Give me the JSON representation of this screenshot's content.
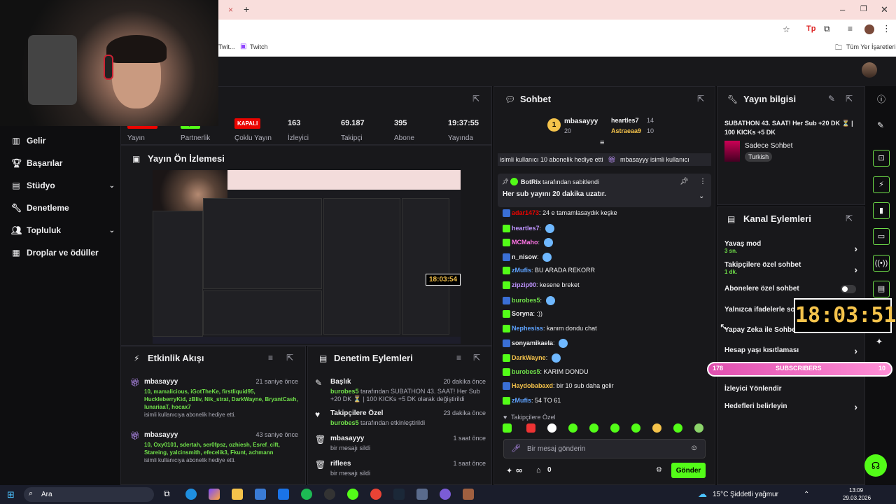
{
  "browser": {
    "bookmarks": {
      "twitch": "Twitch",
      "all": "Tüm Yer İşaretleri",
      "partial": "Twit..."
    }
  },
  "sidebar": {
    "items": [
      {
        "label": "Gelir",
        "icon": "chart-icon"
      },
      {
        "label": "Başarılar",
        "icon": "trophy-icon"
      },
      {
        "label": "Stüdyo",
        "icon": "studio-icon",
        "chevron": "⌄"
      },
      {
        "label": "Denetleme",
        "icon": "wrench-icon"
      },
      {
        "label": "Topluluk",
        "icon": "people-icon",
        "chevron": "⌄"
      },
      {
        "label": "Droplar ve ödüller",
        "icon": "gift-icon"
      }
    ]
  },
  "stats": {
    "title_partial": "i",
    "live_badge": "YAYINDA",
    "partner_badge": "AÇIK",
    "multi_badge": "KAPALI",
    "items": [
      {
        "label": "Yayın"
      },
      {
        "label": "Partnerlik"
      },
      {
        "label": "Çoklu Yayın"
      },
      {
        "value": "163",
        "label": "İzleyici"
      },
      {
        "value": "69.187",
        "label": "Takipçi"
      },
      {
        "value": "395",
        "label": "Abone"
      },
      {
        "value": "19:37:55",
        "label": "Yayında"
      }
    ]
  },
  "preview": {
    "title": "Yayın Ön İzlemesi",
    "mini_clock": "18:03:54"
  },
  "activity": {
    "title": "Etkinlik Akışı",
    "entries": [
      {
        "name": "mbasayyy",
        "time": "21 saniye önce",
        "list": "10, mamalicious, iGotTheKe, firstliquid95, HuckleberryKid, zBliv, Nik_strat, DarkWayne, BryantCash, lunariaaT, hocax7",
        "note": "isimli kullanıcıya abonelik hediye etti."
      },
      {
        "name": "mbasayyy",
        "time": "43 saniye önce",
        "list": "10, Oxy0101, sdertah, ser0fpsz, ozhiesh, Esref_cift, Stareing, yalcinsmith, efecelik3, Fkunt, achmann",
        "note": "isimli kullanıcıya abonelik hediye etti."
      }
    ]
  },
  "moderation": {
    "title": "Denetim Eylemleri",
    "entries": [
      {
        "title": "Başlık",
        "time": "20 dakika önce",
        "user": "burobes5",
        "text": " tarafından SUBATHON 43. SAAT! Her Sub +20 DK ⏳ | 100 KICKs +5 DK olarak değiştirildi",
        "icon": "pencil-icon"
      },
      {
        "title": "Takipçilere Özel",
        "time": "23 dakika önce",
        "user": "burobes5",
        "text": " tarafından etkinleştirildi",
        "icon": "heart-icon"
      },
      {
        "title": "mbasayyy",
        "time": "1 saat önce",
        "user": "",
        "text": "bir mesajı sildi",
        "icon": "trash-icon"
      },
      {
        "title": "riflees",
        "time": "1 saat önce",
        "user": "",
        "text": "bir mesajı sildi",
        "icon": "trash-icon"
      }
    ]
  },
  "chat": {
    "title": "Sohbet",
    "leaderboard": [
      {
        "rank": "1",
        "name": "mbasayyy",
        "count": "20"
      },
      {
        "name": "heartles7",
        "count": "14"
      },
      {
        "name": "Astraeaa9",
        "count": "10"
      }
    ],
    "ticker_left": "isimli kullanıcı 10 abonelik hediye etti",
    "ticker_right": "mbasayyy isimli kullanıcı",
    "pinned_by": "BotRix",
    "pinned_label": " tarafından sabitlendi",
    "pinned_text": "Her sub yayını 20 dakika uzatır.",
    "messages": [
      {
        "user": "adar1473",
        "text": "24 e tamamlasaydık keşke",
        "color": "#eb0400"
      },
      {
        "user": "heartles7",
        "text": "",
        "color": "#bf94ff"
      },
      {
        "user": "MCMaho",
        "text": "",
        "color": "#ff75e6"
      },
      {
        "user": "n_nisow",
        "text": "",
        "color": "#efeff1"
      },
      {
        "user": "zMufis",
        "text": "BU ARADA REKORR",
        "color": "#5ea3ff"
      },
      {
        "user": "zipzip00",
        "text": "kesene breket",
        "color": "#bf94ff"
      },
      {
        "user": "burobes5",
        "text": "",
        "color": "#70e04a"
      },
      {
        "user": "Soryna",
        "text": ":))",
        "color": "#efeff1"
      },
      {
        "user": "Nephesiss",
        "text": "kanım dondu chat",
        "color": "#5ea3ff"
      },
      {
        "user": "sonyamikaela",
        "text": "",
        "color": "#efeff1"
      },
      {
        "user": "DarkWayne",
        "text": "",
        "color": "#f5c34b"
      },
      {
        "user": "burobes5",
        "text": "KARIM DONDU",
        "color": "#70e04a"
      },
      {
        "user": "Haydobabaxd",
        "text": "bir 10 sub daha gelir",
        "color": "#f5c34b"
      },
      {
        "user": "zMufis",
        "text": "54 TO 61",
        "color": "#5ea3ff"
      }
    ],
    "followers_only": "Takipçilere Özel",
    "placeholder": "Bir mesaj gönderin",
    "infinite": "∞",
    "count": "0",
    "send": "Gönder"
  },
  "stream_info": {
    "title": "Yayın bilgisi",
    "stream_title": "SUBATHON 43. SAAT! Her Sub +20 DK ⏳ | 100 KICKs +5 DK",
    "category": "Sadece Sohbet",
    "tag": "Turkish"
  },
  "channel_actions": {
    "title": "Kanal Eylemleri",
    "items": [
      {
        "label": "Yavaş mod",
        "sub": "3 sn."
      },
      {
        "label": "Takipçilere özel sohbet",
        "sub": "1 dk."
      },
      {
        "label": "Abonelere özel sohbet",
        "sub": ""
      },
      {
        "label": "Yalnızca ifadelerle sohbet",
        "sub": ""
      },
      {
        "label": "Yapay Zeka ile Sohbet",
        "sub": ""
      },
      {
        "label": "Hesap yaşı kısıtlaması",
        "sub": ""
      },
      {
        "label": "İzleyici Yönlendir",
        "sub": ""
      },
      {
        "label": "Hedefleri belirleyin",
        "sub": ""
      }
    ]
  },
  "overlay": {
    "clock": "18:03:51",
    "sub_left": "178",
    "sub_label": "SUBSCRIBERS",
    "sub_right": "10"
  },
  "taskbar": {
    "search": "Ara",
    "weather_temp": "15°C",
    "weather_text": "Şiddetli yağmur",
    "time": "13:09",
    "date": "29.03.2026"
  },
  "colors": {
    "accent": "#53fc18",
    "bg": "#0e0e10",
    "panel": "#18181b",
    "live": "#eb0400"
  }
}
